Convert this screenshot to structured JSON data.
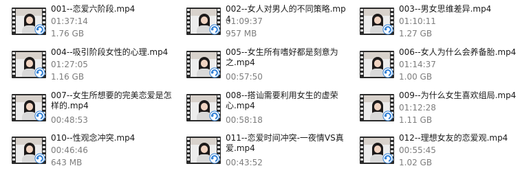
{
  "files": [
    {
      "name": "001--恋爱六阶段.mp4",
      "duration": "01:37:14",
      "size": "1.76 GB"
    },
    {
      "name": "002--女人对男人的不同策略.mp4",
      "duration": "01:09:37",
      "size": "957 MB"
    },
    {
      "name": "003--男女思维差异.mp4",
      "duration": "01:10:11",
      "size": "1.27 GB"
    },
    {
      "name": "004--吸引阶段女性的心理.mp4",
      "duration": "01:27:05",
      "size": "1.16 GB"
    },
    {
      "name": "005--女生所有嗜好都是刻意为之.mp4",
      "duration": "00:57:50",
      "size": ""
    },
    {
      "name": "006--女人为什么会养备胎.mp4",
      "duration": "01:14:37",
      "size": "1.00 GB"
    },
    {
      "name": "007--女生所想要的完美恋爱是怎样的.mp4",
      "duration": "00:48:53",
      "size": ""
    },
    {
      "name": "008--搭讪需要利用女生的虚荣心.mp4",
      "duration": "00:58:18",
      "size": ""
    },
    {
      "name": "009--为什么女生喜欢组局.mp4",
      "duration": "01:12:28",
      "size": "1.11 GB"
    },
    {
      "name": "010--性观念冲突.mp4",
      "duration": "00:46:46",
      "size": "643 MB"
    },
    {
      "name": "011--恋爱时间冲突-一夜情VS真爱.mp4",
      "duration": "00:43:52",
      "size": ""
    },
    {
      "name": "012--理想女友的恋爱观.mp4",
      "duration": "00:55:45",
      "size": "1.02 GB"
    }
  ],
  "icons": {
    "thumbnail": "video-thumbnail-icon",
    "badge": "media-player-badge-icon"
  },
  "colors": {
    "filename": "#1a1a1a",
    "meta": "#7d7d7d",
    "badge_blue": "#2f7fd6",
    "film": "#2a2a2a"
  }
}
